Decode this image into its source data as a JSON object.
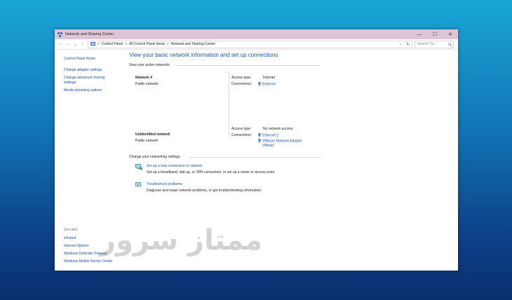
{
  "window": {
    "title": "Network and Sharing Center",
    "controls": {
      "minimize": "—",
      "maximize": "☐",
      "close": "✕"
    }
  },
  "address": {
    "crumbs": [
      "Control Panel",
      "All Control Panel Items",
      "Network and Sharing Center"
    ],
    "separator": ">",
    "search_placeholder": "Search Co..."
  },
  "left_pane": {
    "home": "Control Panel Home",
    "links": [
      "Change adapter settings",
      "Change advanced sharing",
      "settings",
      "Media streaming options"
    ],
    "see_also_title": "See also",
    "see_also": [
      "Infrared",
      "Internet Options",
      "Windows Defender Firewall",
      "Windows Mobile Device Center"
    ]
  },
  "main": {
    "heading": "View your basic network information and set up connections",
    "active_title": "View your active networks",
    "networks": [
      {
        "name": "Network 4",
        "type": "Public network",
        "access_label": "Access type:",
        "access_value": "Internet",
        "conn_label": "Connections:",
        "connections": [
          "Ethernet"
        ]
      },
      {
        "name": "Unidentified network",
        "type": "Public network",
        "access_label": "Access type:",
        "access_value": "No network access",
        "conn_label": "Connections:",
        "connections": [
          "Ethernet 2",
          "VMware Network Adapter",
          "VMnet1"
        ]
      }
    ],
    "change_title": "Change your networking settings",
    "tasks": [
      {
        "link": "Set up a new connection or network",
        "desc": "Set up a broadband, dial-up, or VPN connection; or set up a router or access point."
      },
      {
        "link": "Troubleshoot problems",
        "desc": "Diagnose and repair network problems, or get troubleshooting information."
      }
    ]
  },
  "watermark": "ممتاز سرور",
  "colors": {
    "link": "#1a56b0",
    "titlebar": "#dfc4d8"
  }
}
